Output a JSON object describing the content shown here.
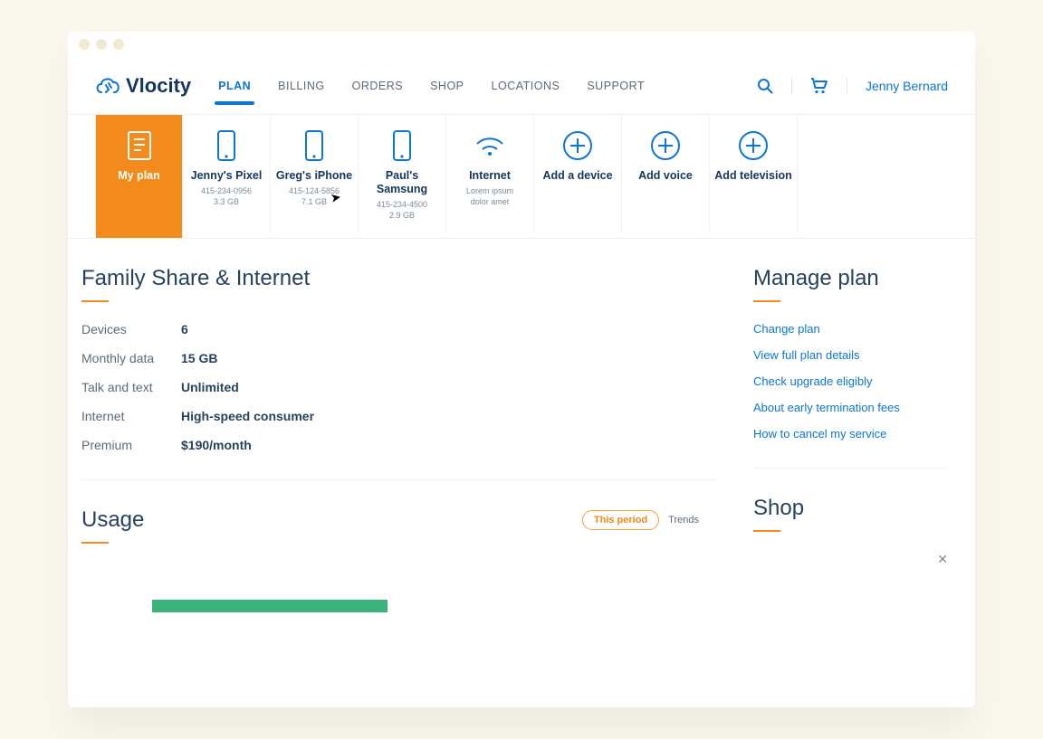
{
  "brand": "Vlocity",
  "user": {
    "name": "Jenny Bernard"
  },
  "nav": {
    "items": [
      {
        "label": "PLAN",
        "active": true
      },
      {
        "label": "BILLING",
        "active": false
      },
      {
        "label": "ORDERS",
        "active": false
      },
      {
        "label": "SHOP",
        "active": false
      },
      {
        "label": "LOCATIONS",
        "active": false
      },
      {
        "label": "SUPPORT",
        "active": false
      }
    ]
  },
  "tiles": [
    {
      "kind": "plan",
      "title": "My plan",
      "sub1": "",
      "sub2": "",
      "active": true,
      "icon": "doc"
    },
    {
      "kind": "device",
      "title": "Jenny's Pixel",
      "sub1": "415-234-0956",
      "sub2": "3.3 GB",
      "icon": "phone"
    },
    {
      "kind": "device",
      "title": "Greg's iPhone",
      "sub1": "415-124-5856",
      "sub2": "7.1 GB",
      "icon": "phone"
    },
    {
      "kind": "device",
      "title": "Paul's Samsung",
      "sub1": "415-234-4500",
      "sub2": "2.9 GB",
      "icon": "phone"
    },
    {
      "kind": "net",
      "title": "Internet",
      "sub1": "Lorem ipsum",
      "sub2": "dolor amet",
      "icon": "wifi"
    },
    {
      "kind": "add",
      "title": "Add a device",
      "sub1": "",
      "sub2": "",
      "icon": "plus"
    },
    {
      "kind": "add",
      "title": "Add voice",
      "sub1": "",
      "sub2": "",
      "icon": "plus"
    },
    {
      "kind": "add",
      "title": "Add television",
      "sub1": "",
      "sub2": "",
      "icon": "plus"
    }
  ],
  "plan": {
    "title": "Family Share & Internet",
    "rows": [
      {
        "k": "Devices",
        "v": "6"
      },
      {
        "k": "Monthly data",
        "v": "15 GB"
      },
      {
        "k": "Talk and text",
        "v": "Unlimited"
      },
      {
        "k": "Internet",
        "v": "High-speed consumer"
      },
      {
        "k": "Premium",
        "v": "$190/month"
      }
    ]
  },
  "manage": {
    "title": "Manage plan",
    "links": [
      "Change plan",
      "View full plan details",
      "Check upgrade eligibly",
      "About early termination fees",
      "How to cancel my service"
    ]
  },
  "usage": {
    "title": "Usage",
    "this_period": "This period",
    "trends": "Trends"
  },
  "shop": {
    "title": "Shop"
  }
}
